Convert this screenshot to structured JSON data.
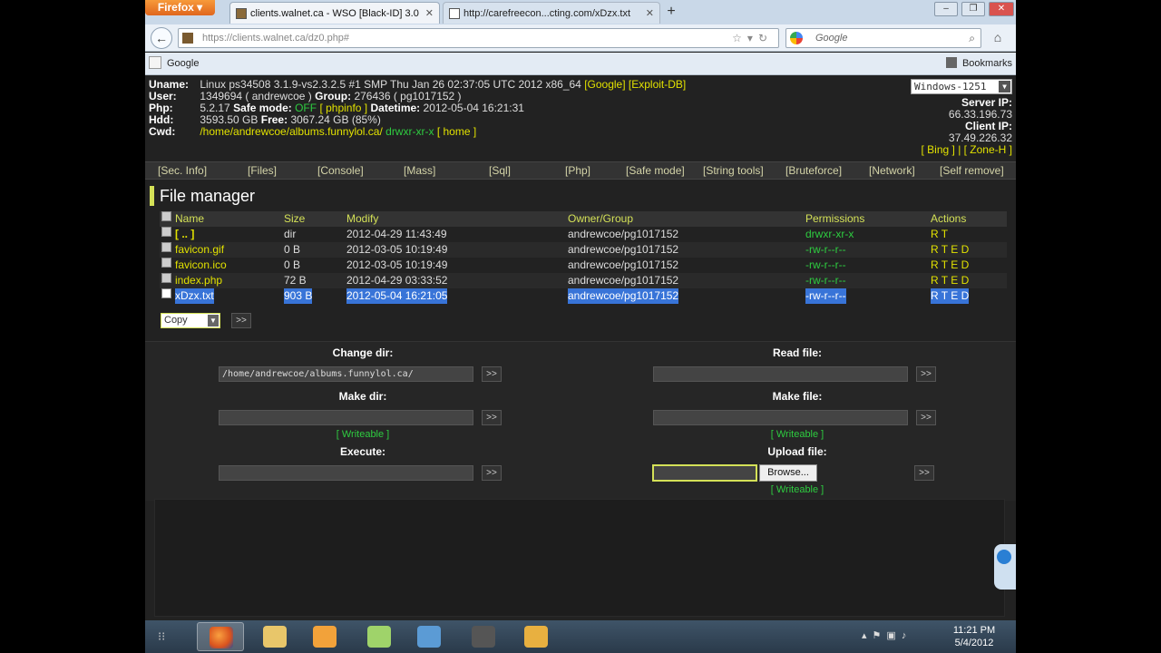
{
  "browser": {
    "firefox_button": "Firefox",
    "tabs": [
      {
        "title": "clients.walnet.ca - WSO [Black-ID] 3.0"
      },
      {
        "title": "http://carefreecon...cting.com/xDzx.txt"
      }
    ],
    "url": "https://clients.walnet.ca/dz0.php#",
    "search_engine": "Google",
    "search_placeholder": "Google",
    "bookmarks": {
      "left": "Google",
      "right": "Bookmarks"
    }
  },
  "server_info": {
    "uname_label": "Uname:",
    "uname": "Linux ps34508 3.1.9-vs2.3.2.5 #1 SMP Thu Jan 26 02:37:05 UTC 2012 x86_64",
    "uname_links": "[Google] [Exploit-DB]",
    "user_label": "User:",
    "user": "1349694 ( andrewcoe )",
    "group_label": "Group:",
    "group": "276436 ( pg1017152 )",
    "php_label": "Php:",
    "php": "5.2.17",
    "safe_mode_label": "Safe mode:",
    "safe_mode": "OFF",
    "phpinfo": "[ phpinfo ]",
    "datetime_label": "Datetime:",
    "datetime": "2012-05-04 16:21:31",
    "hdd_label": "Hdd:",
    "hdd": "3593.50 GB",
    "free_label": "Free:",
    "free": "3067.24 GB (85%)",
    "cwd_label": "Cwd:",
    "cwd": "/home/andrewcoe/albums.funnylol.ca/",
    "cwd_perm": "drwxr-xr-x",
    "home_link": "[ home ]",
    "charset": "Windows-1251",
    "server_ip_label": "Server IP:",
    "server_ip": "66.33.196.73",
    "client_ip_label": "Client IP:",
    "client_ip": "37.49.226.32",
    "bing_zone": "[ Bing ] | [ Zone-H ]"
  },
  "menu": [
    "[Sec. Info]",
    "[Files]",
    "[Console]",
    "[Mass]",
    "[Sql]",
    "[Php]",
    "[Safe mode]",
    "[String tools]",
    "[Bruteforce]",
    "[Network]",
    "[Self remove]"
  ],
  "file_manager": {
    "title": "File manager",
    "headers": {
      "name": "Name",
      "size": "Size",
      "modify": "Modify",
      "owner": "Owner/Group",
      "perms": "Permissions",
      "actions": "Actions"
    },
    "rows": [
      {
        "name": "[ .. ]",
        "size": "dir",
        "modify": "2012-04-29 11:43:49",
        "owner": "andrewcoe/pg1017152",
        "perms": "drwxr-xr-x",
        "actions": "R T"
      },
      {
        "name": "favicon.gif",
        "size": "0 B",
        "modify": "2012-03-05 10:19:49",
        "owner": "andrewcoe/pg1017152",
        "perms": "-rw-r--r--",
        "actions": "R T E D"
      },
      {
        "name": "favicon.ico",
        "size": "0 B",
        "modify": "2012-03-05 10:19:49",
        "owner": "andrewcoe/pg1017152",
        "perms": "-rw-r--r--",
        "actions": "R T E D"
      },
      {
        "name": "index.php",
        "size": "72 B",
        "modify": "2012-04-29 03:33:52",
        "owner": "andrewcoe/pg1017152",
        "perms": "-rw-r--r--",
        "actions": "R T E D"
      },
      {
        "name": "xDzx.txt",
        "size": "903 B",
        "modify": "2012-05-04 16:21:05",
        "owner": "andrewcoe/pg1017152",
        "perms": "-rw-r--r--",
        "actions": "R T E D"
      }
    ],
    "bulk_action": "Copy",
    "go": ">>"
  },
  "tools": {
    "change_dir_label": "Change dir:",
    "change_dir_value": "/home/andrewcoe/albums.funnylol.ca/",
    "read_file_label": "Read file:",
    "make_dir_label": "Make dir:",
    "make_file_label": "Make file:",
    "writeable": "[ Writeable ]",
    "execute_label": "Execute:",
    "upload_label": "Upload file:",
    "browse": "Browse...",
    "go": ">>"
  },
  "taskbar": {
    "time": "11:21 PM",
    "date": "5/4/2012"
  }
}
